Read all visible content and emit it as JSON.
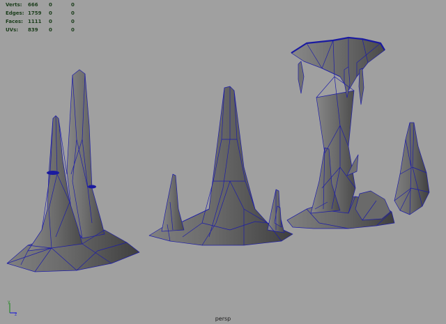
{
  "heads_up_display": {
    "rows": [
      {
        "label": "Verts:",
        "values": [
          "666",
          "0",
          "0"
        ]
      },
      {
        "label": "Edges:",
        "values": [
          "1759",
          "0",
          "0"
        ]
      },
      {
        "label": "Faces:",
        "values": [
          "1111",
          "0",
          "0"
        ]
      },
      {
        "label": "UVs:",
        "values": [
          "839",
          "0",
          "0"
        ]
      }
    ]
  },
  "viewport": {
    "camera": "persp",
    "background_color": "#a0a0a0",
    "wire_color": "#1a1aa0",
    "mesh_color": "#686868"
  },
  "axis_indicator": {
    "y_label": "y",
    "z_label": "z"
  }
}
